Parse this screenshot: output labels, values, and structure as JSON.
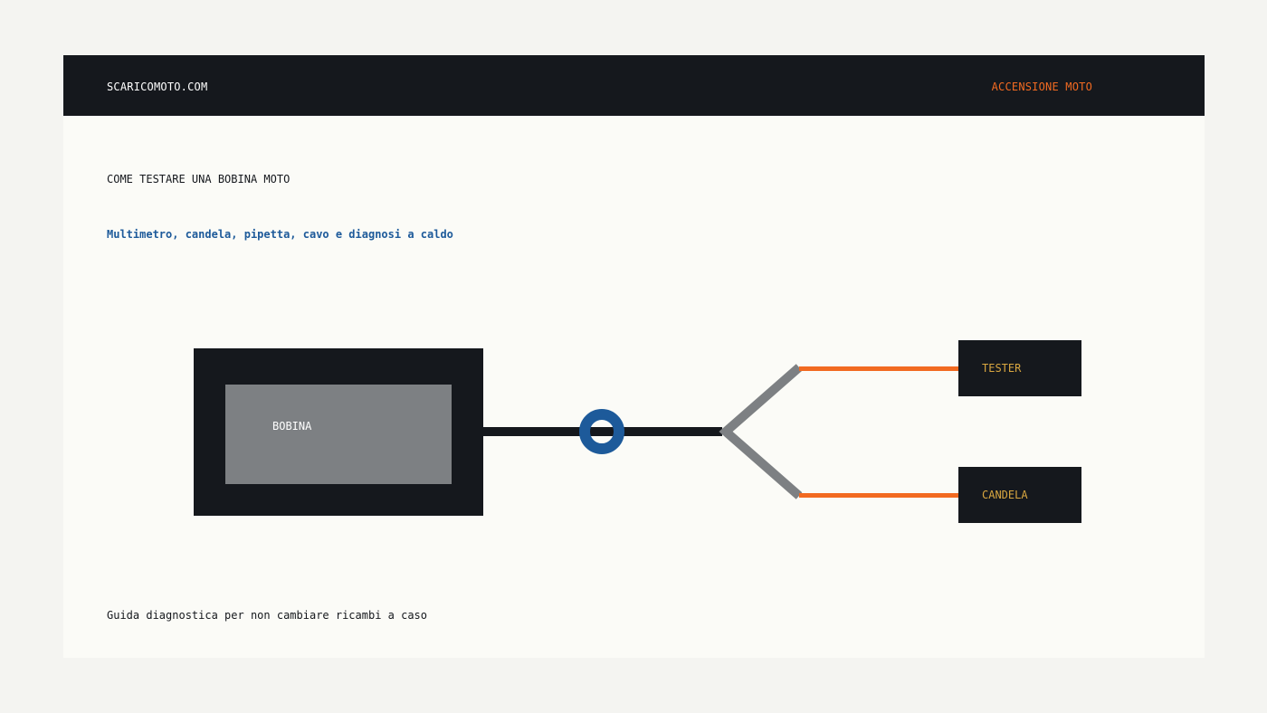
{
  "header": {
    "brand": "SCARICOMOTO.COM",
    "section": "ACCENSIONE MOTO"
  },
  "main": {
    "title": "COME TESTARE UNA BOBINA MOTO",
    "subtitle": "Multimetro, candela, pipetta, cavo e diagnosi a caldo",
    "footer_note": "Guida diagnostica per non cambiare ricambi a caso"
  },
  "diagram": {
    "coil_label": "BOBINA",
    "tester_label": "TESTER",
    "spark_plug_label": "CANDELA"
  },
  "colors": {
    "dark": "#15181d",
    "gray": "#7d8083",
    "orange": "#f26a21",
    "blue": "#1d5a9a",
    "gold": "#d8a640"
  }
}
